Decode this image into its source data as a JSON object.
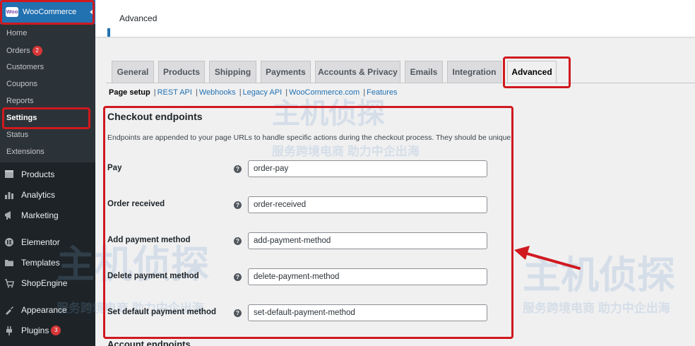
{
  "sidebar": {
    "header_title": "WooCommerce",
    "logo_text": "Woo",
    "submenu": [
      {
        "label": "Home"
      },
      {
        "label": "Orders",
        "badge": "2"
      },
      {
        "label": "Customers"
      },
      {
        "label": "Coupons"
      },
      {
        "label": "Reports"
      },
      {
        "label": "Settings",
        "active": true
      },
      {
        "label": "Status"
      },
      {
        "label": "Extensions"
      }
    ],
    "menu": [
      {
        "label": "Products",
        "icon": "products-icon"
      },
      {
        "label": "Analytics",
        "icon": "analytics-icon"
      },
      {
        "label": "Marketing",
        "icon": "marketing-icon"
      },
      {
        "label": "Elementor",
        "icon": "elementor-icon"
      },
      {
        "label": "Templates",
        "icon": "templates-icon"
      },
      {
        "label": "ShopEngine",
        "icon": "shopengine-icon"
      },
      {
        "label": "Appearance",
        "icon": "appearance-icon"
      },
      {
        "label": "Plugins",
        "icon": "plugins-icon",
        "badge": "3"
      }
    ]
  },
  "header": {
    "title": "Advanced"
  },
  "tabs": [
    {
      "label": "General"
    },
    {
      "label": "Products"
    },
    {
      "label": "Shipping"
    },
    {
      "label": "Payments"
    },
    {
      "label": "Accounts & Privacy"
    },
    {
      "label": "Emails"
    },
    {
      "label": "Integration"
    },
    {
      "label": "Advanced",
      "active": true
    }
  ],
  "subsub": {
    "current": "Page setup",
    "links": [
      "REST API",
      "Webhooks",
      "Legacy API",
      "WooCommerce.com",
      "Features"
    ]
  },
  "section": {
    "title": "Checkout endpoints",
    "description": "Endpoints are appended to your page URLs to handle specific actions during the checkout process. They should be unique.",
    "rows": [
      {
        "label": "Pay",
        "value": "order-pay"
      },
      {
        "label": "Order received",
        "value": "order-received"
      },
      {
        "label": "Add payment method",
        "value": "add-payment-method"
      },
      {
        "label": "Delete payment method",
        "value": "delete-payment-method"
      },
      {
        "label": "Set default payment method",
        "value": "set-default-payment-method"
      }
    ],
    "help_glyph": "?"
  },
  "next_section": {
    "title": "Account endpoints"
  },
  "watermark": {
    "brand": "主机侦探",
    "slogan": "服务跨境电商 助力中企出海"
  },
  "colors": {
    "highlight": "#d0191f",
    "admin_blue": "#2271b1",
    "sidebar": "#1d2327"
  }
}
